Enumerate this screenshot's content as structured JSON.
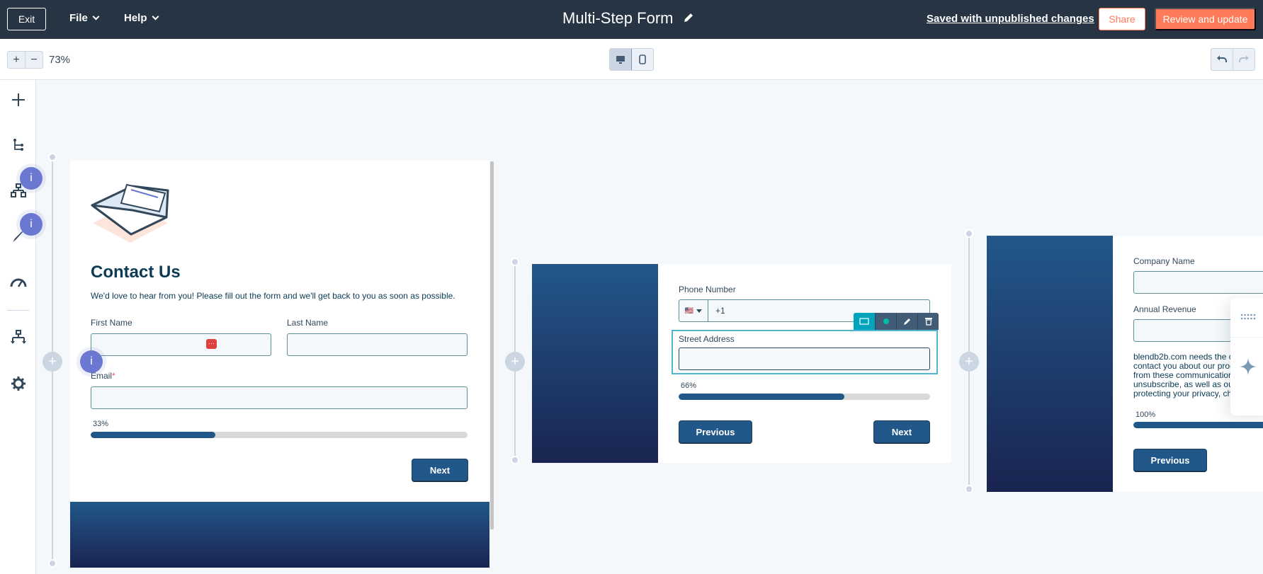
{
  "header": {
    "exit_label": "Exit",
    "menus": [
      {
        "label": "File"
      },
      {
        "label": "Help"
      }
    ],
    "title": "Multi-Step Form",
    "save_status": "Saved with unpublished changes",
    "share_label": "Share",
    "review_label": "Review and update"
  },
  "toolbar": {
    "zoom_in": "+",
    "zoom_out": "−",
    "zoom_level": "73%",
    "device_modes": [
      "desktop",
      "mobile"
    ],
    "active_device": "desktop"
  },
  "rail": {
    "items": [
      {
        "icon": "plus-icon"
      },
      {
        "icon": "tree-icon"
      },
      {
        "icon": "org-chart-icon"
      },
      {
        "icon": "paintbrush-icon"
      },
      {
        "icon": "speedometer-icon"
      },
      {
        "icon": "workflow-icon"
      },
      {
        "icon": "gear-icon"
      }
    ]
  },
  "info_badge": "i",
  "steps": [
    {
      "heading": "Contact Us",
      "description": "We'd love to hear from you! Please fill out the form and we'll get back to you as soon as possible.",
      "fields": [
        {
          "label": "First Name",
          "required": false,
          "value": ""
        },
        {
          "label": "Last Name",
          "required": false,
          "value": ""
        },
        {
          "label": "Email",
          "required": true,
          "value": ""
        }
      ],
      "progress_label": "33%",
      "progress": 0.33,
      "buttons": [
        "Next"
      ]
    },
    {
      "fields": [
        {
          "label": "Phone Number",
          "country_code": "+1",
          "flag": "🇺🇸"
        },
        {
          "label": "Street Address",
          "value": ""
        }
      ],
      "progress_label": "66%",
      "progress": 0.66,
      "buttons": [
        "Previous",
        "Next"
      ]
    },
    {
      "fields": [
        {
          "label": "Company Name",
          "value": ""
        },
        {
          "label": "Annual Revenue",
          "value": ""
        }
      ],
      "consent_lines": [
        "blendb2b.com needs the c",
        "contact you about our proc",
        "from these communicatior",
        "unsubscribe, as well as ou",
        "protecting your privacy, ch"
      ],
      "progress_label": "100%",
      "progress": 1.0,
      "buttons": [
        "Previous"
      ]
    }
  ],
  "colors": {
    "header_bg": "#273444",
    "accent_orange": "#ff7a59",
    "form_button": "#22578a",
    "selection": "#4fb6cb",
    "info_badge": "#6a78d1"
  }
}
